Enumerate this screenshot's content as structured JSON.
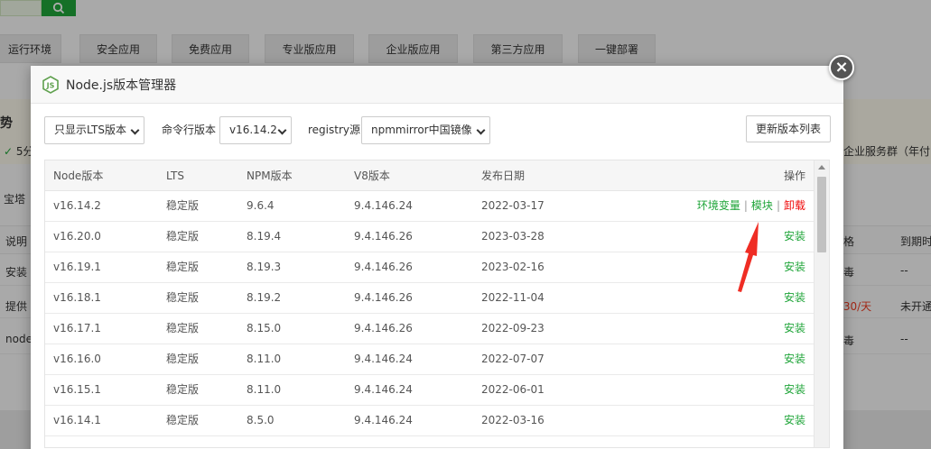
{
  "background": {
    "tabs": [
      "运行环境",
      "安全应用",
      "免费应用",
      "专业版应用",
      "企业版应用",
      "第三方应用",
      "一键部署"
    ],
    "band_title": "势",
    "band_text_left": "5分",
    "band_text_right": "企业服务群（年付",
    "row_label": "宝塔",
    "table_head_left": "说明",
    "table_head_price": "格",
    "table_head_expire": "到期时",
    "rows": [
      {
        "left": "安装",
        "price": "毒",
        "expire": "--"
      },
      {
        "left": "提供",
        "price": ".30/天",
        "expire": "未开通"
      },
      {
        "left": "node",
        "price": "毒",
        "expire": "--"
      }
    ],
    "colors": {
      "green": "#20a53a",
      "red": "#ef3c22"
    }
  },
  "dialog": {
    "title": "Node.js版本管理器",
    "icon": "nodejs-hexagon-icon",
    "close_icon": "close-icon",
    "toolbar": {
      "filter_select": "只显示LTS版本",
      "cmd_label": "命令行版本",
      "cmd_select": "v16.14.2",
      "registry_label": "registry源",
      "registry_select": "npmmirror中国镜像",
      "refresh_button": "更新版本列表"
    },
    "table": {
      "headers": [
        "Node版本",
        "LTS",
        "NPM版本",
        "V8版本",
        "发布日期",
        "操作"
      ],
      "rows": [
        {
          "node": "v16.14.2",
          "lts": "稳定版",
          "npm": "9.6.4",
          "v8": "9.4.146.24",
          "date": "2022-03-17",
          "installed": true
        },
        {
          "node": "v16.20.0",
          "lts": "稳定版",
          "npm": "8.19.4",
          "v8": "9.4.146.26",
          "date": "2023-03-28",
          "installed": false
        },
        {
          "node": "v16.19.1",
          "lts": "稳定版",
          "npm": "8.19.3",
          "v8": "9.4.146.26",
          "date": "2023-02-16",
          "installed": false
        },
        {
          "node": "v16.18.1",
          "lts": "稳定版",
          "npm": "8.19.2",
          "v8": "9.4.146.26",
          "date": "2022-11-04",
          "installed": false
        },
        {
          "node": "v16.17.1",
          "lts": "稳定版",
          "npm": "8.15.0",
          "v8": "9.4.146.26",
          "date": "2022-09-23",
          "installed": false
        },
        {
          "node": "v16.16.0",
          "lts": "稳定版",
          "npm": "8.11.0",
          "v8": "9.4.146.24",
          "date": "2022-07-07",
          "installed": false
        },
        {
          "node": "v16.15.1",
          "lts": "稳定版",
          "npm": "8.11.0",
          "v8": "9.4.146.24",
          "date": "2022-06-01",
          "installed": false
        },
        {
          "node": "v16.14.1",
          "lts": "稳定版",
          "npm": "8.5.0",
          "v8": "9.4.146.24",
          "date": "2022-03-16",
          "installed": false
        }
      ],
      "actions": {
        "env": "环境变量",
        "module": "模块",
        "uninstall": "卸载",
        "install": "安装",
        "separator": "|"
      }
    }
  },
  "annotation": {
    "icon": "red-arrow-icon",
    "color": "#ef2d24"
  }
}
